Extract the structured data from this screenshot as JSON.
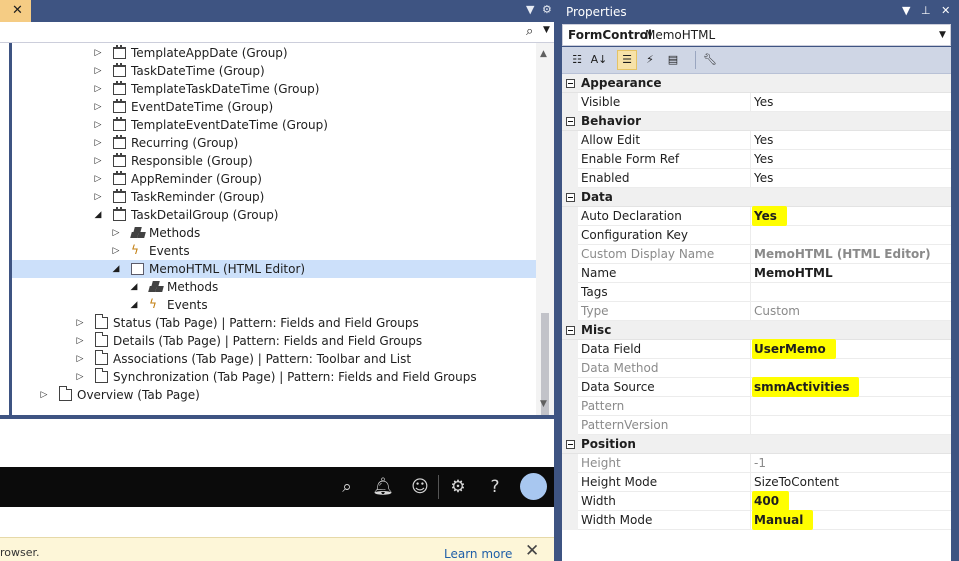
{
  "left": {
    "tab_close": "✕",
    "search_icon": "search-icon",
    "tree": [
      {
        "indent": 1,
        "expander": "collapsed",
        "icon": "group",
        "label": "TemplateAppDate (Group)"
      },
      {
        "indent": 1,
        "expander": "collapsed",
        "icon": "group",
        "label": "TaskDateTime (Group)"
      },
      {
        "indent": 1,
        "expander": "collapsed",
        "icon": "group",
        "label": "TemplateTaskDateTime (Group)"
      },
      {
        "indent": 1,
        "expander": "collapsed",
        "icon": "group",
        "label": "EventDateTime (Group)"
      },
      {
        "indent": 1,
        "expander": "collapsed",
        "icon": "group",
        "label": "TemplateEventDateTime (Group)"
      },
      {
        "indent": 1,
        "expander": "collapsed",
        "icon": "group",
        "label": "Recurring (Group)"
      },
      {
        "indent": 1,
        "expander": "collapsed",
        "icon": "group",
        "label": "Responsible (Group)"
      },
      {
        "indent": 1,
        "expander": "collapsed",
        "icon": "group",
        "label": "AppReminder (Group)"
      },
      {
        "indent": 1,
        "expander": "collapsed",
        "icon": "group",
        "label": "TaskReminder (Group)"
      },
      {
        "indent": 1,
        "expander": "expanded",
        "icon": "group",
        "label": "TaskDetailGroup (Group)"
      },
      {
        "indent": 2,
        "expander": "collapsed",
        "icon": "methods",
        "label": "Methods"
      },
      {
        "indent": 2,
        "expander": "collapsed",
        "icon": "events",
        "label": "Events"
      },
      {
        "indent": 2,
        "expander": "expanded",
        "icon": "html",
        "label": "MemoHTML (HTML Editor)",
        "selected": true
      },
      {
        "indent": 3,
        "expander": "expanded",
        "icon": "methods",
        "label": "Methods"
      },
      {
        "indent": 3,
        "expander": "expanded",
        "icon": "events",
        "label": "Events"
      },
      {
        "indent": 0,
        "expander": "collapsed",
        "icon": "tabpage",
        "label": "Status (Tab Page) | Pattern: Fields and Field Groups"
      },
      {
        "indent": 0,
        "expander": "collapsed",
        "icon": "tabpage",
        "label": "Details (Tab Page) | Pattern: Fields and Field Groups"
      },
      {
        "indent": 0,
        "expander": "collapsed",
        "icon": "tabpage",
        "label": "Associations (Tab Page) | Pattern: Toolbar and List"
      },
      {
        "indent": 0,
        "expander": "collapsed",
        "icon": "tabpage",
        "label": "Synchronization (Tab Page) | Pattern: Fields and Field Groups"
      },
      {
        "indent": -1,
        "expander": "collapsed",
        "icon": "tabpage",
        "label": "Overview (Tab Page)"
      }
    ],
    "app_bar_icons": [
      "search-icon",
      "bell-icon",
      "smiley-icon",
      "gear-icon",
      "help-icon"
    ],
    "notice": {
      "message": "rowser.",
      "link": "Learn more",
      "close": "✕"
    }
  },
  "properties": {
    "title": "Properties",
    "object_type": "FormControl",
    "object_name": "MemoHTML",
    "toolbar": [
      "categorized-icon",
      "alphabetical-icon",
      "properties-icon",
      "events-icon",
      "property-pages-icon",
      "wrench-icon"
    ],
    "categories": [
      {
        "name": "Appearance",
        "props": [
          {
            "name": "Visible",
            "value": "Yes"
          }
        ]
      },
      {
        "name": "Behavior",
        "props": [
          {
            "name": "Allow Edit",
            "value": "Yes"
          },
          {
            "name": "Enable Form Ref",
            "value": "Yes"
          },
          {
            "name": "Enabled",
            "value": "Yes"
          }
        ]
      },
      {
        "name": "Data",
        "props": [
          {
            "name": "Auto Declaration",
            "value": "Yes",
            "bold": true,
            "highlight": true
          },
          {
            "name": "Configuration Key",
            "value": ""
          },
          {
            "name": "Custom Display Name",
            "value": "MemoHTML (HTML Editor)",
            "readonly": true,
            "bold": true
          },
          {
            "name": "Name",
            "value": "MemoHTML",
            "bold": true
          },
          {
            "name": "Tags",
            "value": ""
          },
          {
            "name": "Type",
            "value": "Custom",
            "readonly": true
          }
        ]
      },
      {
        "name": "Misc",
        "props": [
          {
            "name": "Data Field",
            "value": "UserMemo",
            "bold": true,
            "highlight": true
          },
          {
            "name": "Data Method",
            "value": "",
            "readonly": true
          },
          {
            "name": "Data Source",
            "value": "smmActivities",
            "bold": true,
            "highlight": true
          },
          {
            "name": "Pattern",
            "value": "",
            "readonly": true
          },
          {
            "name": "PatternVersion",
            "value": "",
            "readonly": true
          }
        ]
      },
      {
        "name": "Position",
        "props": [
          {
            "name": "Height",
            "value": "-1",
            "readonly": true
          },
          {
            "name": "Height Mode",
            "value": "SizeToContent"
          },
          {
            "name": "Width",
            "value": "400",
            "bold": true,
            "highlight": true
          },
          {
            "name": "Width Mode",
            "value": "Manual",
            "bold": true,
            "highlight": true
          }
        ]
      }
    ]
  }
}
